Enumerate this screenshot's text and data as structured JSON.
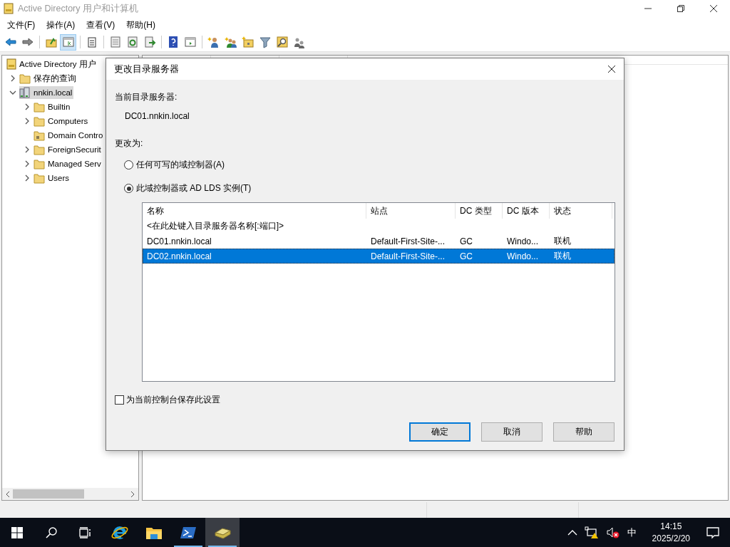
{
  "window": {
    "title": "Active Directory 用户和计算机"
  },
  "menu": [
    {
      "label": "文件(F)"
    },
    {
      "label": "操作(A)"
    },
    {
      "label": "查看(V)"
    },
    {
      "label": "帮助(H)"
    }
  ],
  "toolbar": [
    {
      "selected": false
    },
    {
      "selected": false
    },
    {
      "selected": false
    },
    {
      "selected": true
    },
    {
      "selected": false
    },
    {
      "selected": false
    },
    {
      "selected": false
    },
    {
      "selected": false
    },
    {
      "selected": false
    },
    {
      "selected": false
    },
    {
      "selected": false
    },
    {
      "selected": false
    },
    {
      "selected": false
    },
    {
      "selected": false
    },
    {
      "selected": false
    },
    {
      "selected": false
    }
  ],
  "tree": [
    {
      "label": "Active Directory 用户",
      "kind": "root",
      "expandable": false,
      "selected": false,
      "children": [
        {
          "label": "保存的查询",
          "kind": "folder",
          "expandable": true,
          "expanded": false,
          "selected": false
        },
        {
          "label": "nnkin.local",
          "kind": "domain",
          "expandable": true,
          "expanded": true,
          "selected": true,
          "children": [
            {
              "label": "Builtin",
              "kind": "folder",
              "expandable": true,
              "expanded": false,
              "selected": false
            },
            {
              "label": "Computers",
              "kind": "folder",
              "expandable": true,
              "expanded": false,
              "selected": false
            },
            {
              "label": "Domain Contro",
              "kind": "ou",
              "expandable": false,
              "selected": false
            },
            {
              "label": "ForeignSecurit",
              "kind": "folder",
              "expandable": true,
              "expanded": false,
              "selected": false
            },
            {
              "label": "Managed Serv",
              "kind": "folder",
              "expandable": true,
              "expanded": false,
              "selected": false
            },
            {
              "label": "Users",
              "kind": "folder",
              "expandable": true,
              "expanded": false,
              "selected": false
            }
          ]
        }
      ]
    }
  ],
  "dialog": {
    "title": "更改目录服务器",
    "current_label": "当前目录服务器:",
    "current_server": "DC01.nnkin.local",
    "change_label": "更改为:",
    "options": [
      {
        "label": "任何可写的域控制器(A)",
        "selected": false
      },
      {
        "label": "此域控制器或 AD LDS 实例(T)",
        "selected": true
      }
    ],
    "table": {
      "columns": [
        "名称",
        "站点",
        "DC 类型",
        "DC 版本",
        "状态"
      ],
      "entry_row": "<在此处键入目录服务器名称[:端口]>",
      "rows": [
        {
          "cells": [
            "DC01.nnkin.local",
            "Default-First-Site-...",
            "GC",
            "Windo...",
            "联机"
          ],
          "selected": false
        },
        {
          "cells": [
            "DC02.nnkin.local",
            "Default-First-Site-...",
            "GC",
            "Windo...",
            "联机"
          ],
          "selected": true
        }
      ]
    },
    "save_setting": {
      "label": "为当前控制台保存此设置",
      "checked": false
    },
    "buttons": [
      {
        "label": "确定",
        "default": true
      },
      {
        "label": "取消",
        "default": false
      },
      {
        "label": "帮助",
        "default": false
      }
    ]
  },
  "taskbar": {
    "apps": [
      {
        "running": false,
        "selected": false
      },
      {
        "running": false,
        "selected": false
      },
      {
        "running": true,
        "selected": false
      },
      {
        "running": true,
        "selected": true
      }
    ],
    "ime": "中",
    "time": "14:15",
    "date": "2025/2/20"
  }
}
